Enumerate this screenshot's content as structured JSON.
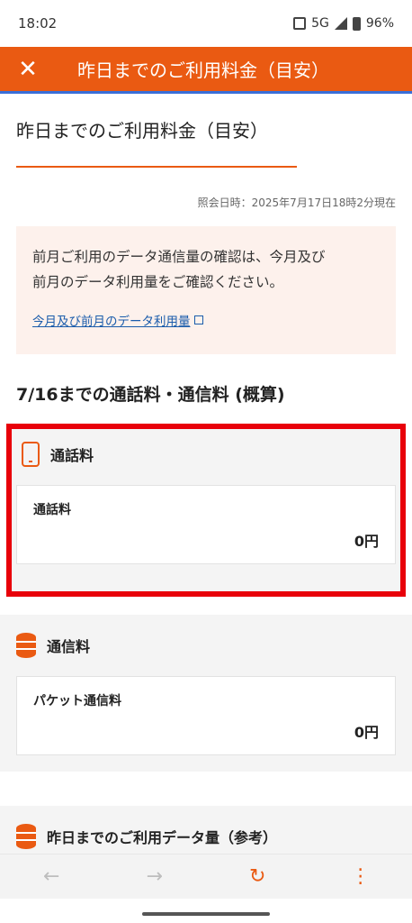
{
  "status_bar": {
    "time": "18:02",
    "network": "5G",
    "battery": "96%"
  },
  "header": {
    "close_icon": "close-icon",
    "title": "昨日までのご利用料金（目安）"
  },
  "page": {
    "title": "昨日までのご利用料金（目安）",
    "timestamp": "照会日時：2025年7月17日18時2分現在",
    "notice": {
      "line1": "前月ご利用のデータ通信量の確認は、今月及び",
      "line2": "前月のデータ利用量をご確認ください。",
      "link": "今月及び前月のデータ利用量"
    },
    "section_heading": "7/16までの通話料・通信料 (概算)",
    "call_card": {
      "head": "通話料",
      "item_label": "通話料",
      "item_value": "0円"
    },
    "data_card": {
      "head": "通信料",
      "item_label": "パケット通信料",
      "item_value": "0円"
    },
    "usage_card": {
      "head": "昨日までのご利用データ量（参考）"
    }
  },
  "nav": {
    "back": "←",
    "forward": "→",
    "reload": "↻",
    "menu": "⋮"
  },
  "colors": {
    "accent": "#ea5a12",
    "highlight": "#e8000a",
    "link": "#1a5cab"
  }
}
